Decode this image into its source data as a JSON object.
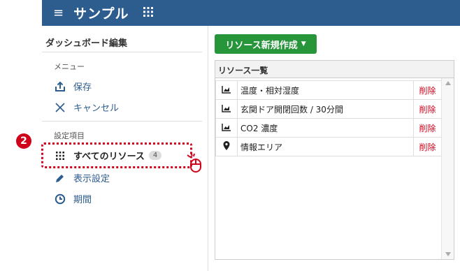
{
  "topbar": {
    "title": "サンプル",
    "menu_icon": "hamburger-icon",
    "apps_icon": "grid-icon"
  },
  "sidebar": {
    "title": "ダッシュボード編集",
    "menu_label": "メニュー",
    "save_label": "保存",
    "cancel_label": "キャンセル",
    "settings_label": "設定項目",
    "all_resources_label": "すべてのリソース",
    "all_resources_count": "4",
    "display_settings_label": "表示設定",
    "period_label": "期間"
  },
  "callout": {
    "number": "2"
  },
  "main": {
    "new_resource_button": "リソース新規作成",
    "list_title": "リソース一覧",
    "rows": [
      {
        "icon": "area-chart-icon",
        "name": "温度・相対湿度",
        "action": "削除"
      },
      {
        "icon": "area-chart-icon",
        "name": "玄関ドア開閉回数 / 30分間",
        "action": "削除"
      },
      {
        "icon": "area-chart-icon",
        "name": "CO2 濃度",
        "action": "削除"
      },
      {
        "icon": "map-marker-icon",
        "name": "情報エリア",
        "action": "削除"
      }
    ]
  },
  "colors": {
    "topbar": "#2d5d8f",
    "accent": "#2d5d8f",
    "button": "#27953a",
    "delete": "#d0021b",
    "callout": "#d0021b"
  }
}
